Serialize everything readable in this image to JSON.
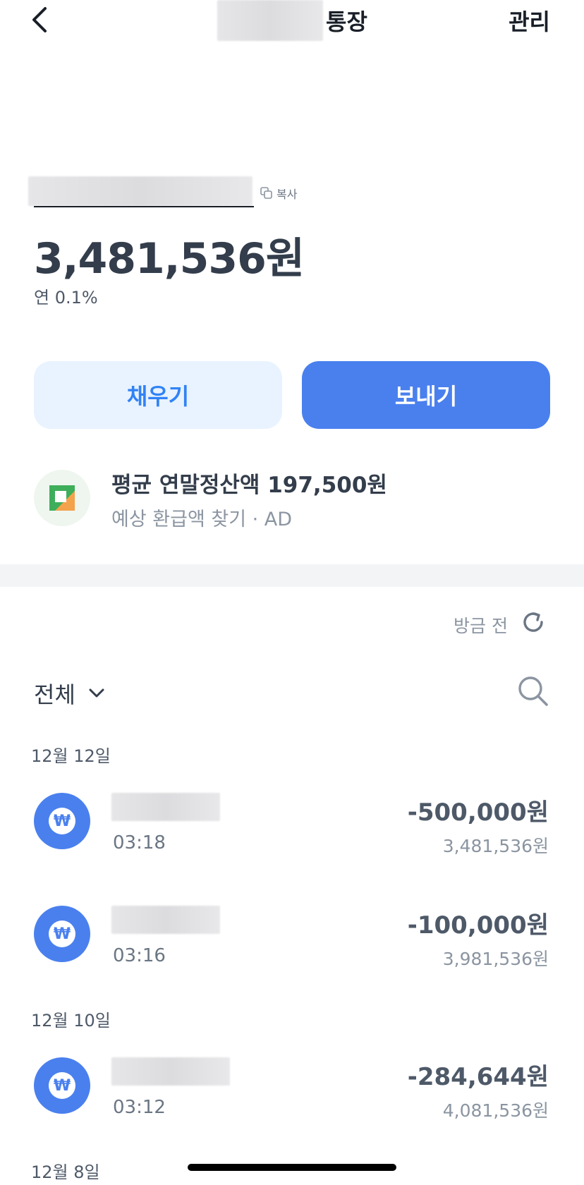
{
  "header": {
    "title": "통장",
    "manage_label": "관리"
  },
  "account": {
    "copy_label": "복사",
    "balance": "3,481,536원",
    "interest_rate": "연 0.1%"
  },
  "actions": {
    "fill_label": "채우기",
    "send_label": "보내기"
  },
  "ad": {
    "title": "평균 연말정산액 197,500원",
    "subtitle": "예상 환급액 찾기 · AD"
  },
  "history": {
    "refresh_label": "방금 전",
    "filter_label": "전체",
    "groups": [
      {
        "date": "12월 12일",
        "transactions": [
          {
            "time": "03:18",
            "amount": "-500,000원",
            "balance": "3,481,536원"
          },
          {
            "time": "03:16",
            "amount": "-100,000원",
            "balance": "3,981,536원"
          }
        ]
      },
      {
        "date": "12월 10일",
        "transactions": [
          {
            "time": "03:12",
            "amount": "-284,644원",
            "balance": "4,081,536원"
          }
        ]
      },
      {
        "date": "12월 8일",
        "transactions": []
      }
    ]
  },
  "icons": {
    "back": "chevron-left-icon",
    "copy": "copy-icon",
    "refresh": "refresh-icon",
    "filter": "chevron-down-icon",
    "search": "search-icon",
    "transaction": "won-icon"
  },
  "colors": {
    "primary": "#4a80ee",
    "primary_light": "#e8f3ff",
    "text_dark": "#333d4b",
    "text_gray": "#8b95a1"
  }
}
